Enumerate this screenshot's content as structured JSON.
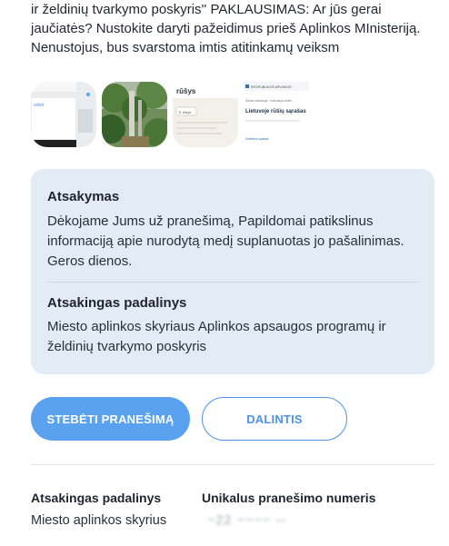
{
  "report": {
    "intro_text": "ir želdinių tvarkymo poskyris'' PAKLAUSIMAS: Ar jūs gerai jaučiatės? Nustokite daryti pažeidimus prieš Aplinkos MInisteriją. Nenustojus, bus svarstoma imtis atitinkamų veiksm"
  },
  "attachments": {
    "thumb3": {
      "heading": "rūšys",
      "chip": "Tr rūšys"
    },
    "thumb4": {
      "topbar": "REGPUBLIKOS APLINKOS",
      "crumbs": "Šanda instrukcija · Inomacijos Aldes",
      "heading": "Lietuvoje rūšių sąrašas",
      "link": "Koliekinis sąrašas"
    }
  },
  "answer": {
    "heading": "Atsakymas",
    "text": "Dėkojame Jums už pranešimą, Papildomai patikslinus informaciją apie nurodytą medį suplanuotas jo pašalinimas. Geros dienos.",
    "unit_heading": "Atsakingas padalinys",
    "unit_text": "Miesto aplinkos skyriaus Aplinkos apsaugos programų ir želdinių tvarkymo poskyris"
  },
  "actions": {
    "follow_label": "STEBĖTI PRANEŠIMĄ",
    "share_label": "DALINTIS"
  },
  "info": {
    "unit_label": "Atsakingas padalinys",
    "unit_value": "Miesto aplinkos skyrius",
    "number_label": "Unikalus pranešimo numeris",
    "number_value": "~22 ~~~~ --"
  },
  "colors": {
    "accent": "#5aa1f0",
    "accent_dark": "#4d93ea",
    "card_bg": "#e3ebf5"
  }
}
